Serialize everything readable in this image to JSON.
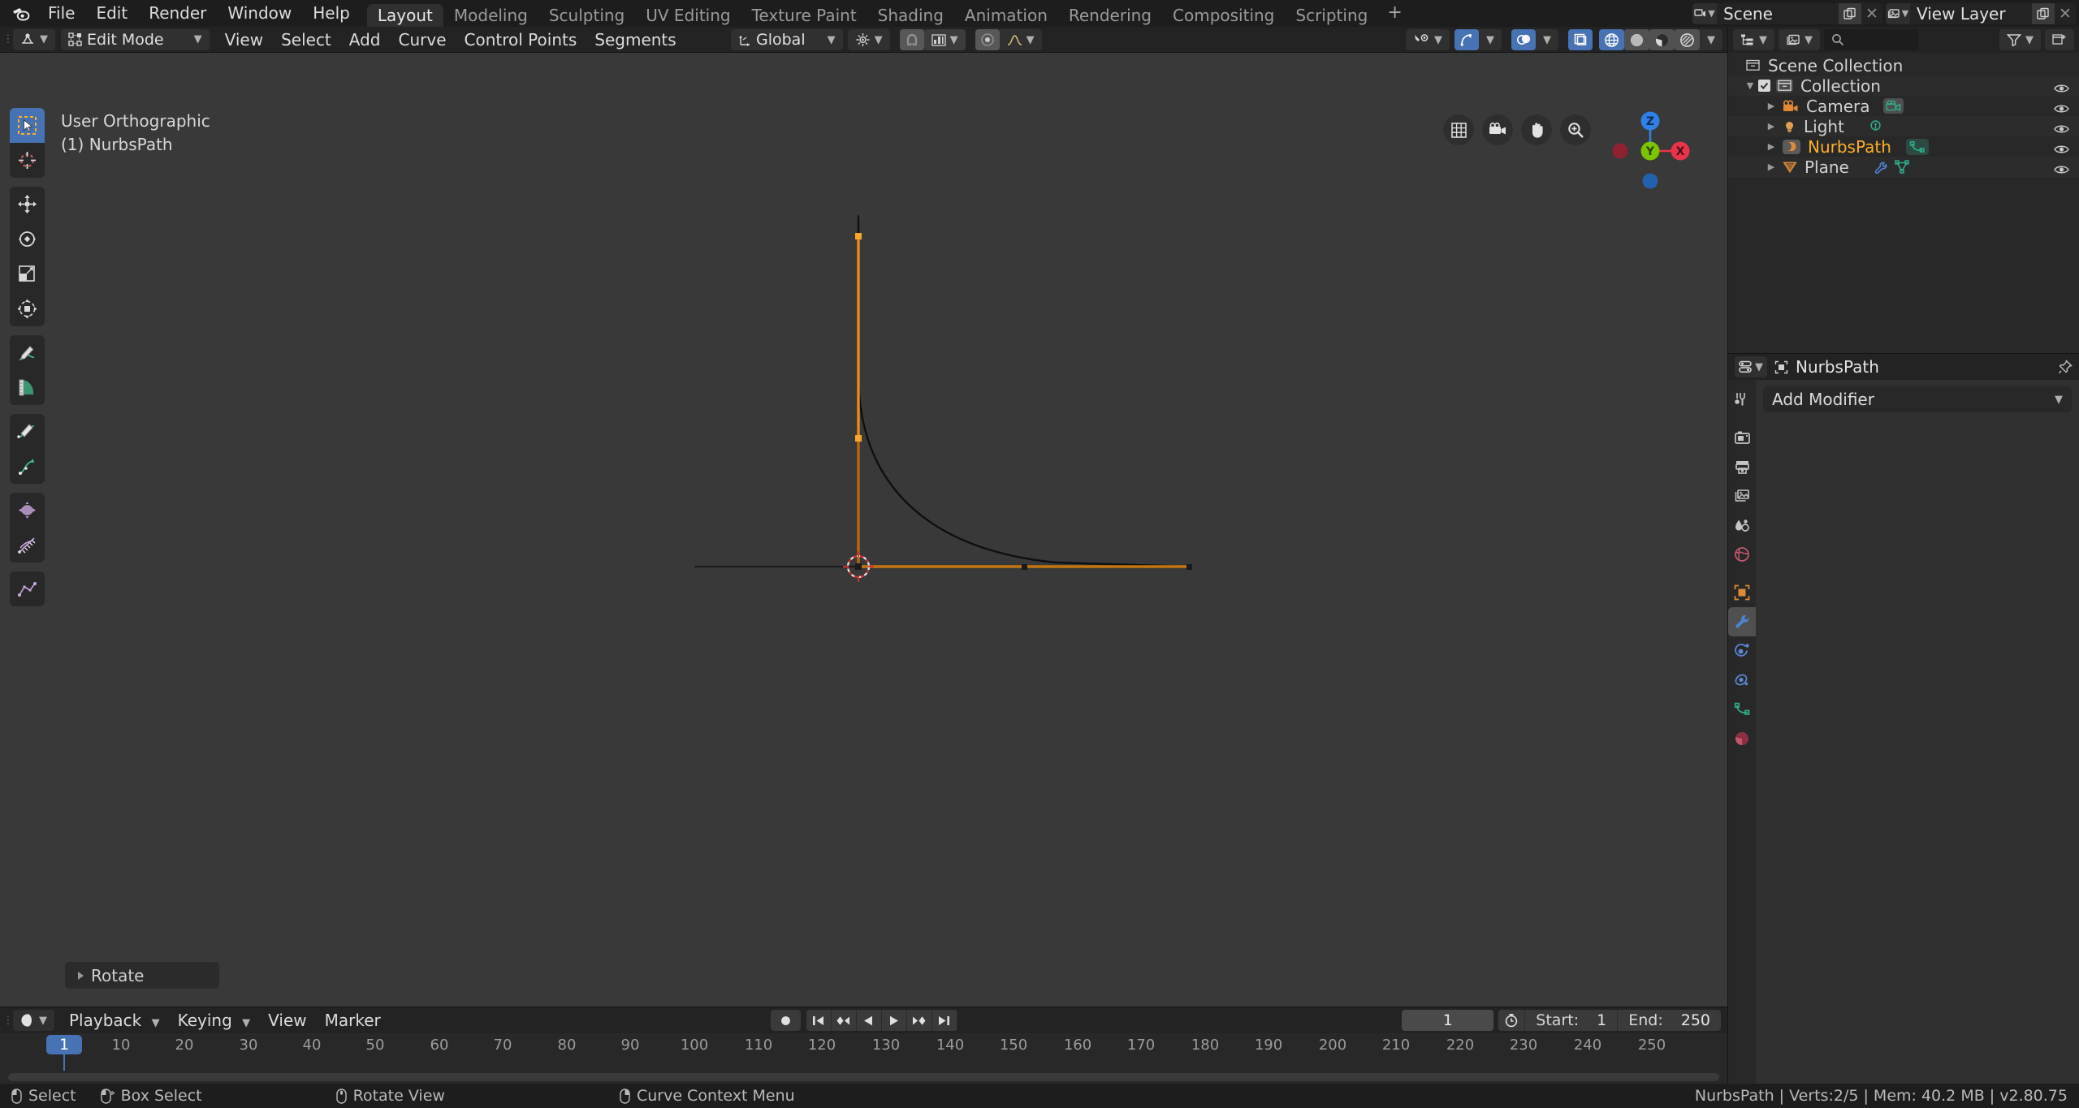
{
  "app": {
    "logo_icon": "blender-logo-icon"
  },
  "topbar": {
    "menus": [
      "File",
      "Edit",
      "Render",
      "Window",
      "Help"
    ],
    "workspaces": [
      "Layout",
      "Modeling",
      "Sculpting",
      "UV Editing",
      "Texture Paint",
      "Shading",
      "Animation",
      "Rendering",
      "Compositing",
      "Scripting"
    ],
    "active_workspace": "Layout",
    "add_workspace_label": "+",
    "scene_name": "Scene",
    "view_layer_name": "View Layer"
  },
  "viewport_header": {
    "mode": "Edit Mode",
    "menus": [
      "View",
      "Select",
      "Add",
      "Curve",
      "Control Points",
      "Segments"
    ],
    "transform_orientation": "Global"
  },
  "viewport": {
    "view_name": "User Orthographic",
    "object_line": "(1) NurbsPath",
    "gizmo": {
      "z_label": "Z",
      "y_label": "Y",
      "x_label": "X",
      "z_color": "#2f81e8",
      "y_color": "#7ac400",
      "x_color": "#e8344a"
    },
    "operator_panel": "Rotate",
    "tools": [
      "tweak-select-box-icon",
      "cursor-icon",
      "move-icon",
      "rotate-icon",
      "scale-icon",
      "transform-icon",
      "draw-curve-icon",
      "measure-icon",
      "extrude-icon",
      "curve-draw-icon",
      "shrink-fatten-icon",
      "tilt-icon",
      "curve-pen-icon"
    ],
    "active_tool": "tweak-select-box-icon",
    "nav_buttons": [
      "toggle-grid-icon",
      "camera-view-icon",
      "pan-view-icon",
      "zoom-view-icon"
    ],
    "shading_modes": [
      "wireframe",
      "solid",
      "material-preview",
      "rendered"
    ],
    "active_shading": "wireframe"
  },
  "outliner": {
    "search_placeholder": "",
    "rows": [
      {
        "label": "Scene Collection",
        "icon": "collection-icon",
        "indent": 0,
        "has_eye": false,
        "selected": false
      },
      {
        "label": "Collection",
        "icon": "collection-icon",
        "indent": 1,
        "has_eye": true,
        "selected": false,
        "checkbox": true,
        "expanded": true
      },
      {
        "label": "Camera",
        "icon": "camera-object-icon",
        "indent": 2,
        "has_eye": true,
        "selected": false,
        "data_icon": "camera-data-icon"
      },
      {
        "label": "Light",
        "icon": "light-object-icon",
        "indent": 2,
        "has_eye": true,
        "selected": false,
        "data_icon": "light-data-icon"
      },
      {
        "label": "NurbsPath",
        "icon": "curve-object-icon",
        "indent": 2,
        "has_eye": true,
        "selected": true,
        "data_icon": "curve-data-icon"
      },
      {
        "label": "Plane",
        "icon": "mesh-object-icon",
        "indent": 2,
        "has_eye": true,
        "selected": false,
        "data_icon": "modifier-icon",
        "data_icon2": "mesh-data-icon"
      }
    ]
  },
  "properties": {
    "breadcrumb_object": "NurbsPath",
    "add_modifier_label": "Add Modifier",
    "tabs": [
      "tool-icon",
      "render-icon",
      "output-icon",
      "view-layer-icon",
      "scene-icon",
      "world-icon",
      "object-icon",
      "modifier-icon",
      "physics-icon",
      "constraints-icon",
      "curve-data-icon",
      "material-icon"
    ],
    "active_tab": "modifier-icon"
  },
  "timeline": {
    "editor_icon": "timeline-editor-icon",
    "menus": [
      "Playback",
      "Keying",
      "View",
      "Marker"
    ],
    "playback_buttons": [
      "record-icon",
      "jump-start-icon",
      "prev-keyframe-icon",
      "play-reverse-icon",
      "play-icon",
      "next-keyframe-icon",
      "jump-end-icon"
    ],
    "current_frame": "1",
    "start_label": "Start:",
    "start_value": "1",
    "end_label": "End:",
    "end_value": "250",
    "ticks": [
      "10",
      "20",
      "30",
      "40",
      "50",
      "60",
      "70",
      "80",
      "90",
      "100",
      "110",
      "120",
      "130",
      "140",
      "150",
      "160",
      "170",
      "180",
      "190",
      "200",
      "210",
      "220",
      "230",
      "240",
      "250"
    ],
    "playhead_frame": "1"
  },
  "statusbar": {
    "hints": [
      {
        "icon": "mouse-left-icon",
        "label": "Select"
      },
      {
        "icon": "mouse-left-drag-icon",
        "label": "Box Select"
      },
      {
        "icon": "mouse-middle-icon",
        "label": "Rotate View"
      },
      {
        "icon": "mouse-right-icon",
        "label": "Curve Context Menu"
      }
    ],
    "info": "NurbsPath | Verts:2/5 | Mem: 40.2 MB | v2.80.75"
  },
  "colors": {
    "accent_blue": "#4772b3",
    "select_orange": "#ffaf29",
    "curve_orange": "#e28b1e",
    "viewport_bg": "#393939",
    "panel_bg": "#282828",
    "header_bg": "#232323"
  }
}
